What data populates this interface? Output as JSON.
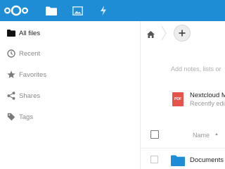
{
  "header": {
    "logo": "nextcloud-logo",
    "nav": [
      {
        "name": "files",
        "icon": "folder-icon",
        "active": true
      },
      {
        "name": "photos",
        "icon": "image-icon",
        "active": false
      },
      {
        "name": "activity",
        "icon": "lightning-icon",
        "active": false
      }
    ],
    "colors": {
      "brand": "#1e8dd6"
    }
  },
  "sidebar": {
    "items": [
      {
        "label": "All files",
        "icon": "folder-icon",
        "active": true
      },
      {
        "label": "Recent",
        "icon": "clock-icon",
        "active": false
      },
      {
        "label": "Favorites",
        "icon": "star-icon",
        "active": false
      },
      {
        "label": "Shares",
        "icon": "share-icon",
        "active": false
      },
      {
        "label": "Tags",
        "icon": "tag-icon",
        "active": false
      }
    ]
  },
  "main": {
    "breadcrumb": {
      "home_icon": "home-icon",
      "add_icon": "plus-icon"
    },
    "notes_placeholder": "Add notes, lists or",
    "recommended": {
      "file_type": "PDF",
      "title": "Nextcloud M",
      "subtitle": "Recently edi"
    },
    "table": {
      "column_name": "Name",
      "sort_indicator": "▲",
      "rows": [
        {
          "name": "Documents",
          "icon": "folder-icon"
        }
      ]
    }
  }
}
